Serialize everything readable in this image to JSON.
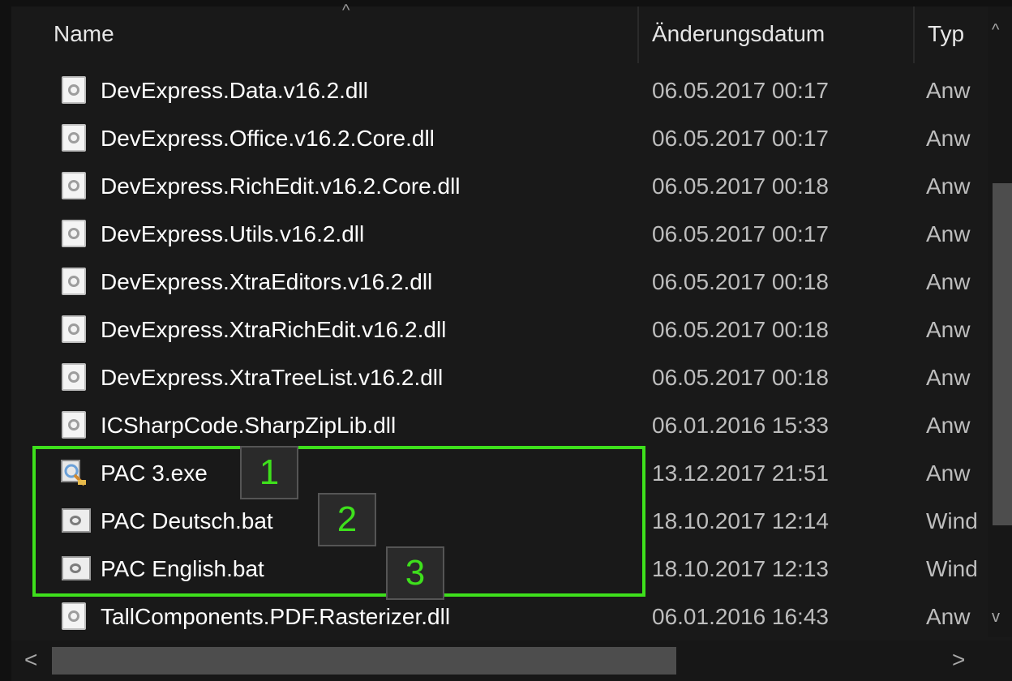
{
  "header": {
    "sort_indicator": "^",
    "columns": [
      "Name",
      "Änderungsdatum",
      "Typ"
    ]
  },
  "files": [
    {
      "name": "DevExpress.Data.v16.2.dll",
      "modified": "06.05.2017 00:17",
      "type": "Anw",
      "icon": "dll-icon"
    },
    {
      "name": "DevExpress.Office.v16.2.Core.dll",
      "modified": "06.05.2017 00:17",
      "type": "Anw",
      "icon": "dll-icon"
    },
    {
      "name": "DevExpress.RichEdit.v16.2.Core.dll",
      "modified": "06.05.2017 00:18",
      "type": "Anw",
      "icon": "dll-icon"
    },
    {
      "name": "DevExpress.Utils.v16.2.dll",
      "modified": "06.05.2017 00:17",
      "type": "Anw",
      "icon": "dll-icon"
    },
    {
      "name": "DevExpress.XtraEditors.v16.2.dll",
      "modified": "06.05.2017 00:18",
      "type": "Anw",
      "icon": "dll-icon"
    },
    {
      "name": "DevExpress.XtraRichEdit.v16.2.dll",
      "modified": "06.05.2017 00:18",
      "type": "Anw",
      "icon": "dll-icon"
    },
    {
      "name": "DevExpress.XtraTreeList.v16.2.dll",
      "modified": "06.05.2017 00:18",
      "type": "Anw",
      "icon": "dll-icon"
    },
    {
      "name": "ICSharpCode.SharpZipLib.dll",
      "modified": "06.01.2016 15:33",
      "type": "Anw",
      "icon": "dll-icon"
    },
    {
      "name": "PAC 3.exe",
      "modified": "13.12.2017 21:51",
      "type": "Anw",
      "icon": "exe-icon"
    },
    {
      "name": "PAC Deutsch.bat",
      "modified": "18.10.2017 12:14",
      "type": "Wind",
      "icon": "bat-icon"
    },
    {
      "name": "PAC English.bat",
      "modified": "18.10.2017 12:13",
      "type": "Wind",
      "icon": "bat-icon"
    },
    {
      "name": "TallComponents.PDF.Rasterizer.dll",
      "modified": "06.01.2016 16:43",
      "type": "Anw",
      "icon": "dll-icon"
    }
  ],
  "badges": [
    "1",
    "2",
    "3"
  ],
  "scrollbars": {
    "up": "^",
    "down": "v",
    "left": "<",
    "right": ">",
    "vertical_position": 0.42,
    "horizontal_position": 0.0
  },
  "colors": {
    "background": "#191919",
    "highlight": "#3ee01c",
    "badge_text": "#3ee01c"
  }
}
